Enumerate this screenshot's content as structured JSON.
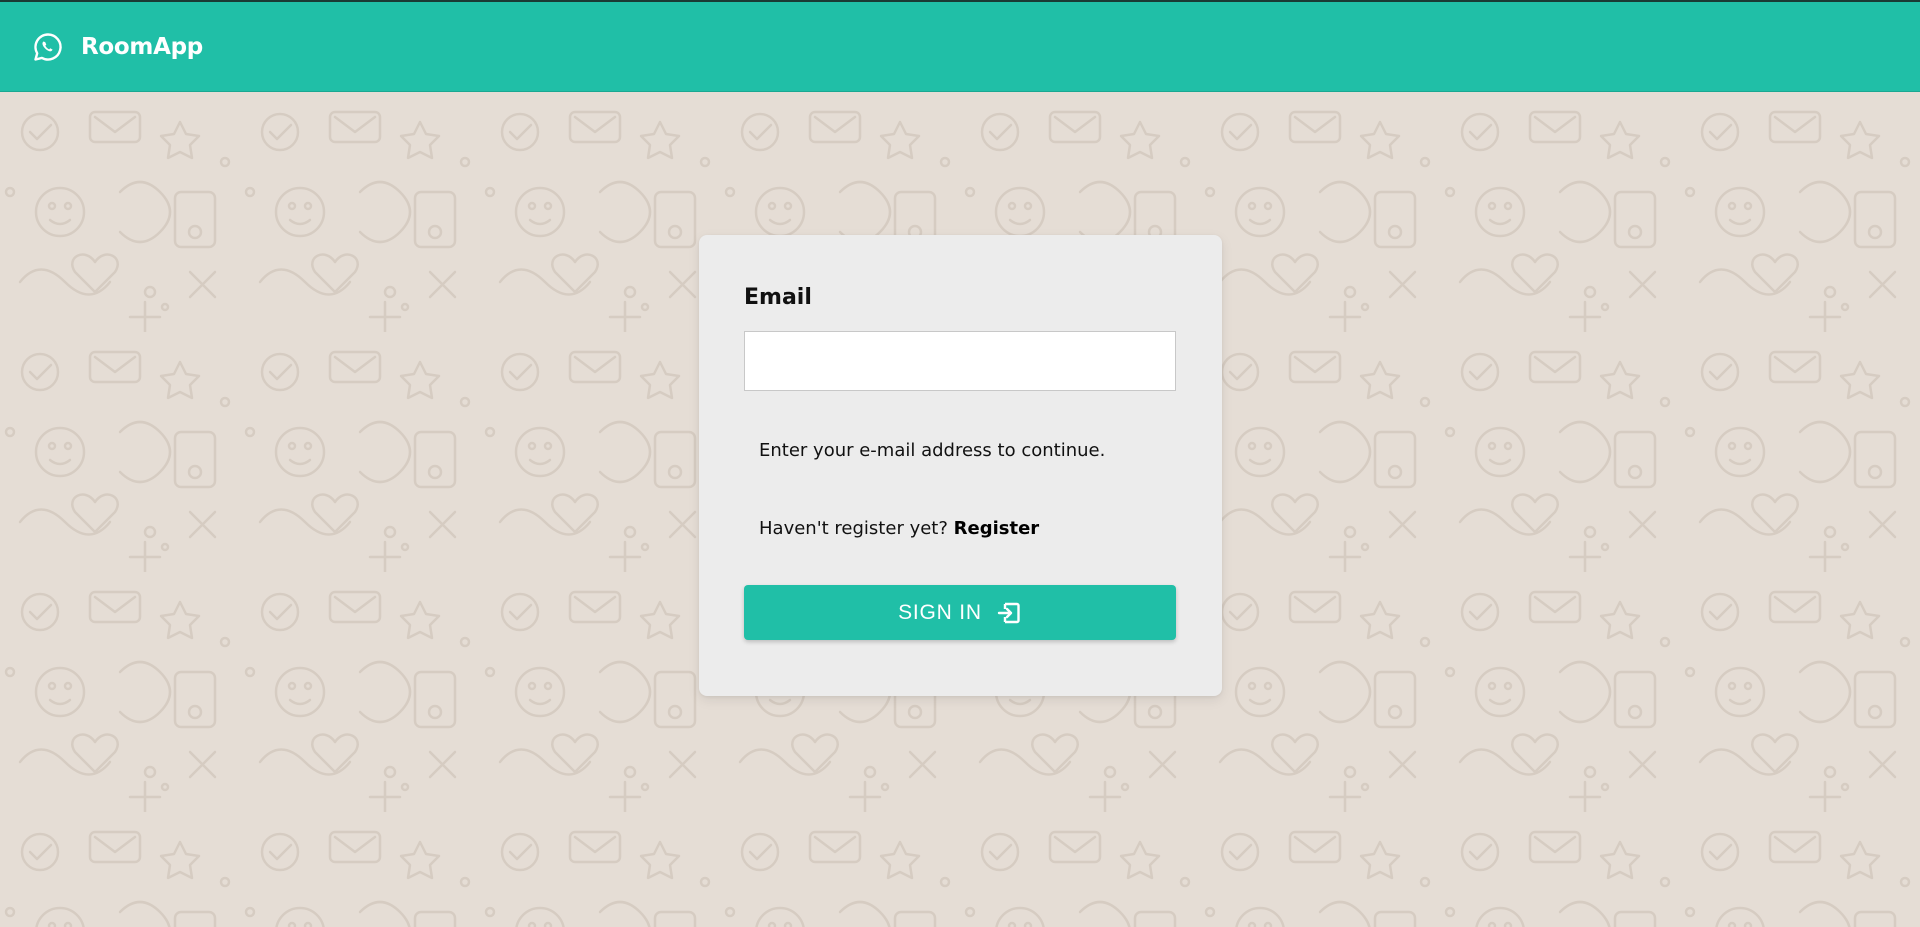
{
  "header": {
    "app_title": "RoomApp",
    "logo_icon": "whatsapp-chat-icon",
    "background_color": "#20bfa7"
  },
  "login": {
    "email_label": "Email",
    "email_value": "",
    "email_placeholder": "",
    "helper_text": "Enter your e-mail address to continue.",
    "register_prompt": "Haven't register yet?",
    "register_link": "Register",
    "signin_label": "SIGN IN",
    "signin_icon": "sign-in-icon"
  },
  "colors": {
    "accent": "#20bfa7",
    "page_background": "#e5ddd5",
    "card_background": "#ececec"
  }
}
